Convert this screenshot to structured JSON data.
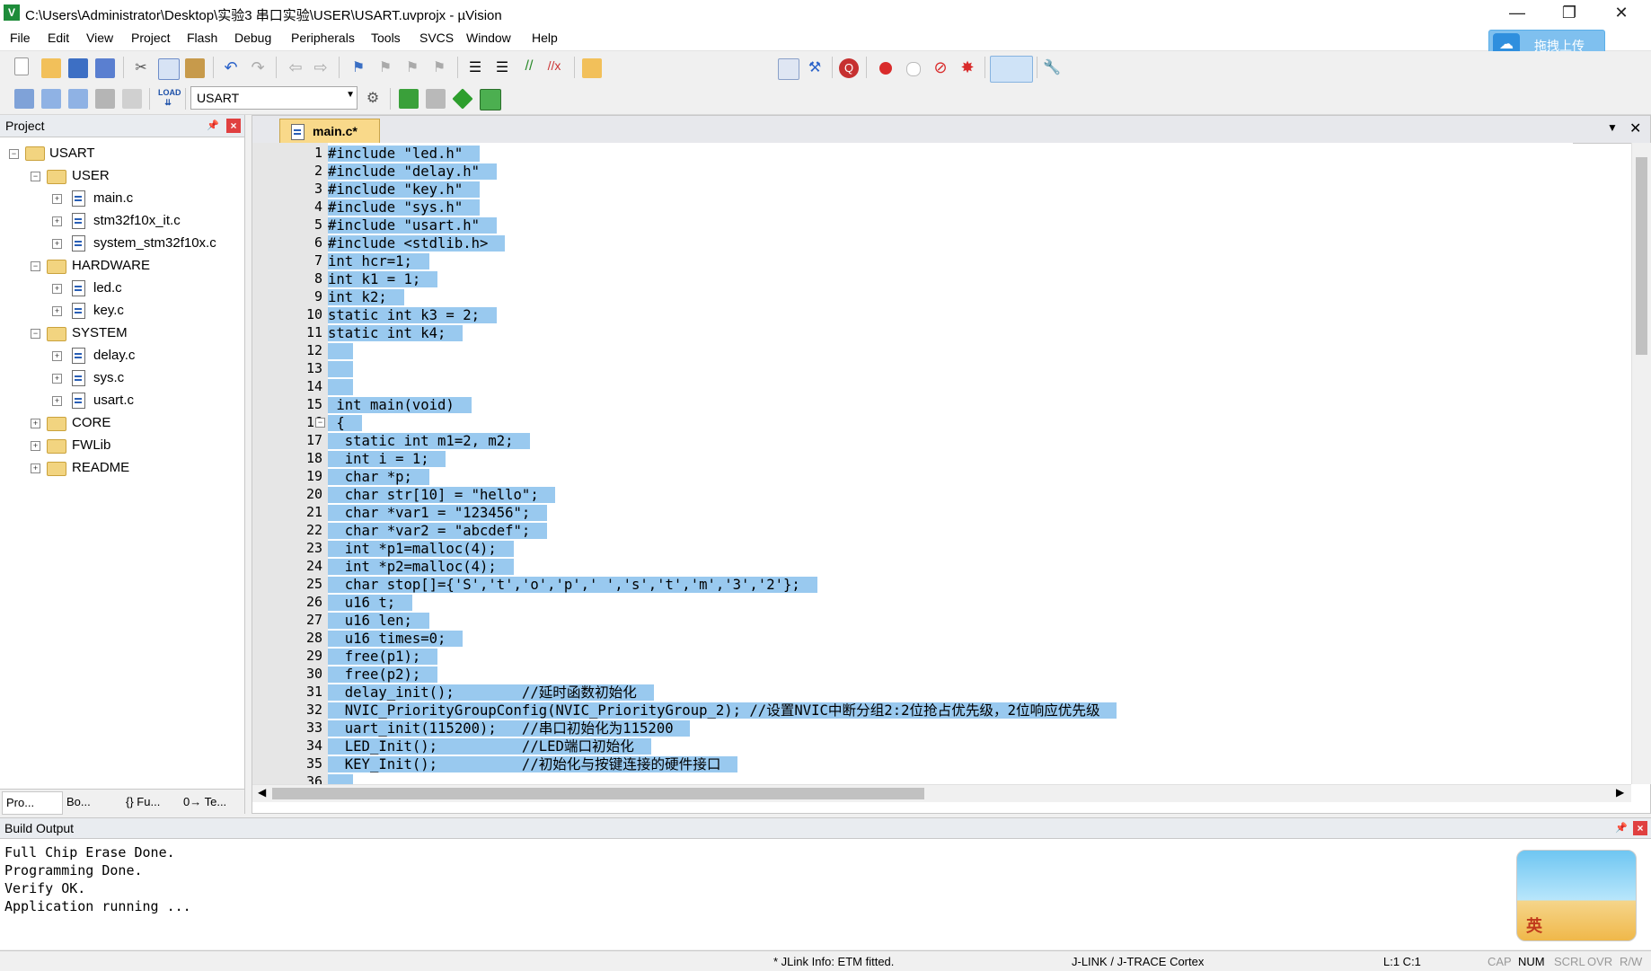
{
  "window": {
    "title": "C:\\Users\\Administrator\\Desktop\\实验3 串口实验\\USER\\USART.uvprojx - µVision",
    "min_glyph": "—",
    "restore_glyph": "❐",
    "close_glyph": "✕"
  },
  "menu": [
    "File",
    "Edit",
    "View",
    "Project",
    "Flash",
    "Debug",
    "Peripherals",
    "Tools",
    "SVCS",
    "Window",
    "Help"
  ],
  "cloud_button": {
    "label": "拖拽上传",
    "icon": "cloud-icon"
  },
  "toolbar2": {
    "target_select": "USART"
  },
  "project": {
    "header": "Project",
    "tree": [
      {
        "label": "USART",
        "kind": "root",
        "level": 0,
        "expanded": true
      },
      {
        "label": "USER",
        "kind": "folder",
        "level": 1,
        "expanded": true
      },
      {
        "label": "main.c",
        "kind": "file",
        "level": 2
      },
      {
        "label": "stm32f10x_it.c",
        "kind": "file",
        "level": 2
      },
      {
        "label": "system_stm32f10x.c",
        "kind": "file",
        "level": 2
      },
      {
        "label": "HARDWARE",
        "kind": "folder",
        "level": 1,
        "expanded": true
      },
      {
        "label": "led.c",
        "kind": "file",
        "level": 2
      },
      {
        "label": "key.c",
        "kind": "file",
        "level": 2
      },
      {
        "label": "SYSTEM",
        "kind": "folder",
        "level": 1,
        "expanded": true
      },
      {
        "label": "delay.c",
        "kind": "file",
        "level": 2
      },
      {
        "label": "sys.c",
        "kind": "file",
        "level": 2
      },
      {
        "label": "usart.c",
        "kind": "file",
        "level": 2
      },
      {
        "label": "CORE",
        "kind": "folder",
        "level": 1,
        "expanded": false
      },
      {
        "label": "FWLib",
        "kind": "folder",
        "level": 1,
        "expanded": false
      },
      {
        "label": "README",
        "kind": "folder",
        "level": 1,
        "expanded": false
      }
    ],
    "tabs": [
      "Pro...",
      "Bo...",
      "{} Fu...",
      "0→ Te..."
    ]
  },
  "editor": {
    "tab_label": "main.c*",
    "lines": [
      "#include \"led.h\"",
      "#include \"delay.h\"",
      "#include \"key.h\"",
      "#include \"sys.h\"",
      "#include \"usart.h\"",
      "#include <stdlib.h>",
      "int hcr=1;",
      "int k1 = 1;",
      "int k2;",
      "static int k3 = 2;",
      "static int k4;",
      "",
      "",
      "",
      " int main(void)",
      " {",
      "  static int m1=2, m2;",
      "  int i = 1;",
      "  char *p;",
      "  char str[10] = \"hello\";",
      "  char *var1 = \"123456\";",
      "  char *var2 = \"abcdef\";",
      "  int *p1=malloc(4);",
      "  int *p2=malloc(4);",
      "  char stop[]={'S','t','o','p',' ','s','t','m','3','2'};",
      "  u16 t;",
      "  u16 len;",
      "  u16 times=0;",
      "  free(p1);",
      "  free(p2);",
      "  delay_init();        //延时函数初始化",
      "  NVIC_PriorityGroupConfig(NVIC_PriorityGroup_2); //设置NVIC中断分组2:2位抢占优先级，2位响应优先级",
      "  uart_init(115200);   //串口初始化为115200",
      "  LED_Init();          //LED端口初始化",
      "  KEY_Init();          //初始化与按键连接的硬件接口",
      ""
    ]
  },
  "build_output": {
    "header": "Build Output",
    "lines": [
      "Full Chip Erase Done.",
      "Programming Done.",
      "Verify OK.",
      "Application running ..."
    ],
    "ime_widget_text": "英"
  },
  "status": {
    "jlink_info": "* JLink Info: ETM fitted.",
    "debugger": "J-LINK / J-TRACE Cortex",
    "cursor": "L:1 C:1",
    "cap": "CAP",
    "num": "NUM",
    "scrl": "SCRL",
    "ovr": "OVR",
    "rw": "R/W"
  },
  "colors": {
    "selection": "#99c9ef",
    "tab_active": "#f9d98a",
    "folder": "#f2d480",
    "close_red": "#e04040"
  }
}
